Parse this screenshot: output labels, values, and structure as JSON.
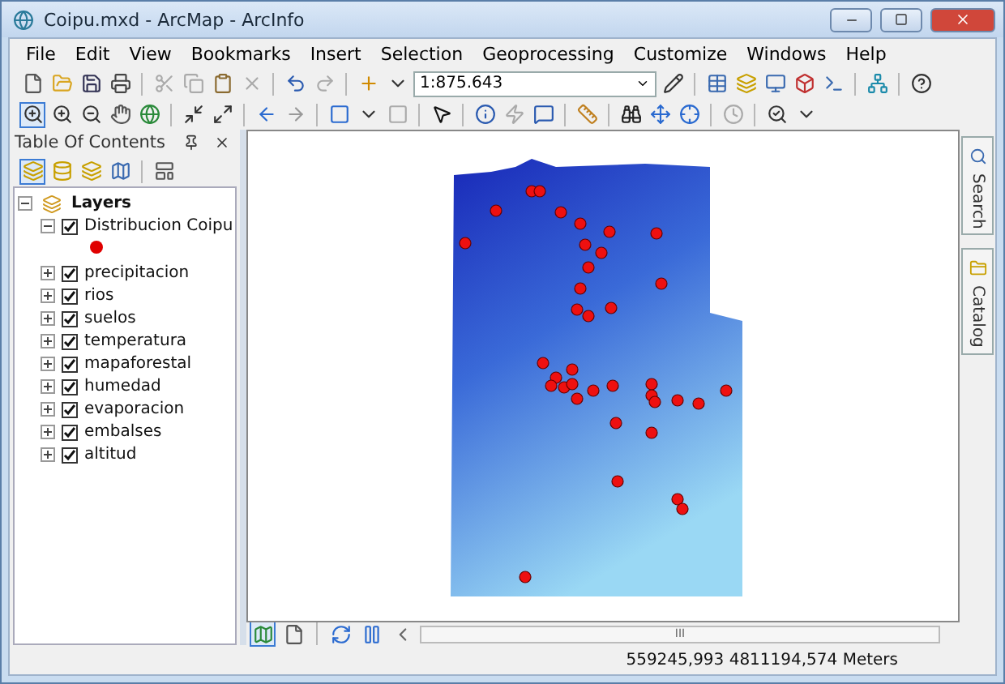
{
  "window": {
    "title": "Coipu.mxd - ArcMap - ArcInfo"
  },
  "menu": [
    "File",
    "Edit",
    "View",
    "Bookmarks",
    "Insert",
    "Selection",
    "Geoprocessing",
    "Customize",
    "Windows",
    "Help"
  ],
  "toolbar": {
    "scale": "1:875.643"
  },
  "toc": {
    "title": "Table Of Contents",
    "root": {
      "label": "Layers",
      "expanded": true,
      "children": [
        {
          "label": "Distribucion Coipu",
          "checked": true,
          "expanded": true
        },
        {
          "label": "precipitacion",
          "checked": true,
          "expanded": false
        },
        {
          "label": "rios",
          "checked": true,
          "expanded": false
        },
        {
          "label": "suelos",
          "checked": true,
          "expanded": false
        },
        {
          "label": "temperatura",
          "checked": true,
          "expanded": false
        },
        {
          "label": "mapaforestal",
          "checked": true,
          "expanded": false
        },
        {
          "label": "humedad",
          "checked": true,
          "expanded": false
        },
        {
          "label": "evaporacion",
          "checked": true,
          "expanded": false
        },
        {
          "label": "embalses",
          "checked": true,
          "expanded": false
        },
        {
          "label": "altitud",
          "checked": true,
          "expanded": false
        }
      ]
    }
  },
  "side_tabs": [
    "Search",
    "Catalog"
  ],
  "scrollbar_grip": "III",
  "status_bar": {
    "coordinates": "559245,993  4811194,574 Meters"
  }
}
